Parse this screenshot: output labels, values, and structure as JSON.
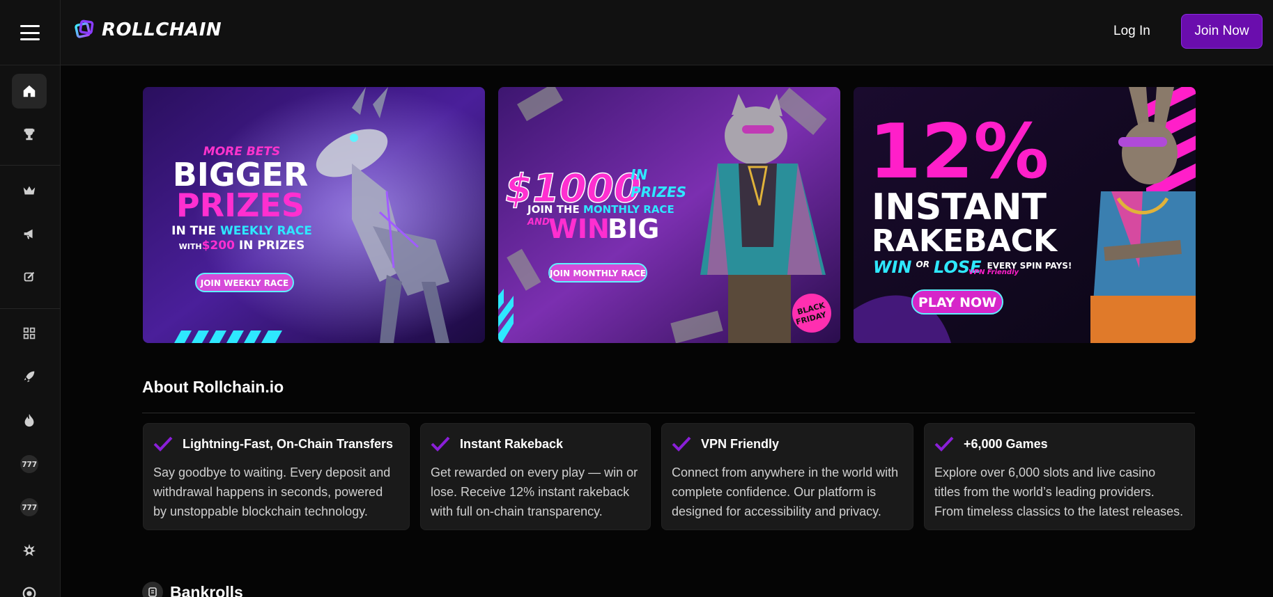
{
  "header": {
    "brand": "ROLLCHAIN",
    "login_label": "Log In",
    "join_label": "Join Now",
    "accent": "#6a0dad"
  },
  "sidebar": {
    "items": [
      {
        "icon": "home-icon",
        "active": true
      },
      {
        "icon": "trophy-icon"
      },
      {
        "icon": "crown-icon"
      },
      {
        "icon": "megaphone-icon"
      },
      {
        "icon": "edit-icon"
      },
      {
        "icon": "grid-icon"
      },
      {
        "icon": "rocket-icon"
      },
      {
        "icon": "fire-icon"
      },
      {
        "icon": "slots-777-icon",
        "label": "777"
      },
      {
        "icon": "slots-777-icon",
        "label": "777"
      },
      {
        "icon": "burst-icon"
      },
      {
        "icon": "chip-icon"
      }
    ]
  },
  "banners": [
    {
      "name": "weekly-race",
      "line1": "MORE BETS",
      "line2": "BIGGER",
      "line3": "PRIZES",
      "line4a": "IN THE ",
      "line4b": "WEEKLY RACE",
      "line5a": "WITH",
      "line5b": "$200",
      "line5c": " IN PRIZES",
      "button": "JOIN WEEKLY RACE"
    },
    {
      "name": "monthly-race",
      "amount": "$1000",
      "in": "IN",
      "prizes": "PRIZES",
      "line2a": "JOIN THE ",
      "line2b": "MONTHLY RACE",
      "and": "AND",
      "win": "WIN",
      "big": "BIG",
      "button": "JOIN MONTHLY RACE",
      "badge1": "BLACK",
      "badge2": "FRIDAY"
    },
    {
      "name": "rakeback",
      "percent": "12%",
      "line2": "INSTANT",
      "line3": "RAKEBACK",
      "win": "WIN",
      "or": "OR",
      "lose": "LOSE",
      "every": "EVERY SPIN PAYS!",
      "vpn": "VPN Friendly",
      "button": "PLAY NOW"
    }
  ],
  "about": {
    "title": "About Rollchain.io",
    "cards": [
      {
        "title": "Lightning-Fast, On-Chain Transfers",
        "text": "Say goodbye to waiting. Every deposit and withdrawal happens in seconds, powered by unstoppable blockchain technology."
      },
      {
        "title": "Instant Rakeback",
        "text": "Get rewarded on every play — win or lose. Receive 12% instant rakeback with full on-chain transparency."
      },
      {
        "title": "VPN Friendly",
        "text": "Connect from anywhere in the world with complete confidence. Our platform is designed for accessibility and privacy."
      },
      {
        "title": "+6,000 Games",
        "text": "Explore over 6,000 slots and live casino titles from the world’s leading providers. From timeless classics to the latest releases."
      }
    ]
  },
  "bankrolls": {
    "title": "Bankrolls"
  }
}
